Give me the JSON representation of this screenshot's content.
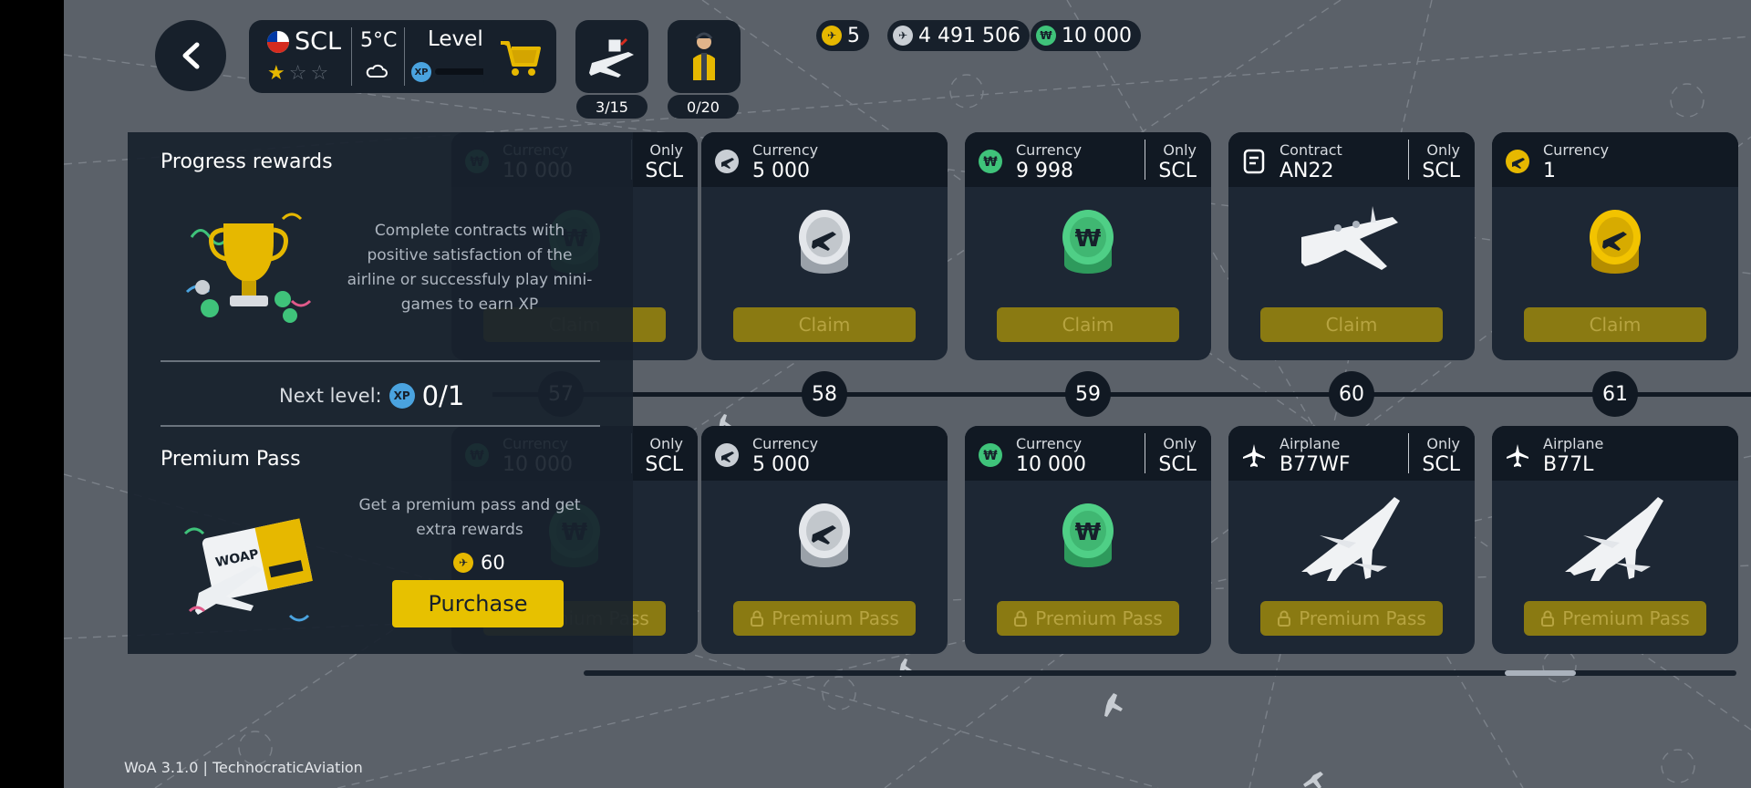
{
  "header": {
    "airport_code": "SCL",
    "temperature": "5°C",
    "level_label": "Level 0",
    "xp_badge": "XP",
    "stars_filled": 1,
    "stars_total": 3,
    "cargo_count": "3/15",
    "staff_count": "0/20",
    "currencies": [
      {
        "icon": "gold-plane-coin-icon",
        "value": "5",
        "color": "#e6b800"
      },
      {
        "icon": "silver-plane-coin-icon",
        "value": "4 491 506",
        "color": "#c9ced4"
      },
      {
        "icon": "green-w-coin-icon",
        "value": "10 000",
        "color": "#3fc37a"
      }
    ]
  },
  "top_row": [
    {
      "type_label": "Currency",
      "value": "10 000",
      "only_label": "Only",
      "only_value": "SCL",
      "icon": "green-w-coin-icon",
      "art": "green-coin",
      "button": "Claim"
    },
    {
      "type_label": "Currency",
      "value": "5 000",
      "only_label": "",
      "only_value": "",
      "icon": "silver-plane-coin-icon",
      "art": "silver-coin",
      "button": "Claim"
    },
    {
      "type_label": "Currency",
      "value": "9 998",
      "only_label": "Only",
      "only_value": "SCL",
      "icon": "green-w-coin-icon",
      "art": "green-coin",
      "button": "Claim"
    },
    {
      "type_label": "Contract",
      "value": "AN22",
      "only_label": "Only",
      "only_value": "SCL",
      "icon": "contract-icon",
      "art": "turboprop-plane",
      "button": "Claim"
    },
    {
      "type_label": "Currency",
      "value": "1",
      "only_label": "",
      "only_value": "",
      "icon": "gold-plane-coin-icon",
      "art": "gold-coin",
      "button": "Claim"
    }
  ],
  "levels": [
    "57",
    "58",
    "59",
    "60",
    "61"
  ],
  "bottom_row": [
    {
      "type_label": "Currency",
      "value": "10 000",
      "only_label": "Only",
      "only_value": "SCL",
      "icon": "green-w-coin-icon",
      "art": "green-coin",
      "button": "Premium Pass"
    },
    {
      "type_label": "Currency",
      "value": "5 000",
      "only_label": "",
      "only_value": "",
      "icon": "silver-plane-coin-icon",
      "art": "silver-coin",
      "button": "Premium Pass"
    },
    {
      "type_label": "Currency",
      "value": "10 000",
      "only_label": "Only",
      "only_value": "SCL",
      "icon": "green-w-coin-icon",
      "art": "green-coin",
      "button": "Premium Pass"
    },
    {
      "type_label": "Airplane",
      "value": "B77WF",
      "only_label": "Only",
      "only_value": "SCL",
      "icon": "airplane-icon",
      "art": "jet-plane",
      "button": "Premium Pass"
    },
    {
      "type_label": "Airplane",
      "value": "B77L",
      "only_label": "",
      "only_value": "",
      "icon": "airplane-icon",
      "art": "jet-plane",
      "button": "Premium Pass"
    }
  ],
  "progress_panel": {
    "title": "Progress rewards",
    "description": "Complete contracts with positive satisfaction of the airline or successfuly play mini-games to earn XP",
    "next_level_label": "Next level:",
    "xp_badge": "XP",
    "next_level_value": "0/1"
  },
  "premium_panel": {
    "title": "Premium Pass",
    "description": "Get a premium pass and get extra rewards",
    "price": "60",
    "purchase_label": "Purchase",
    "pass_card_text": "WOAP"
  },
  "footer": {
    "version": "WoA 3.1.0 | TechnocraticAviation"
  },
  "colors": {
    "accent": "#e7c100",
    "panel": "#17202b",
    "claim_button": "#8a7a12",
    "map": "#5b6169"
  }
}
